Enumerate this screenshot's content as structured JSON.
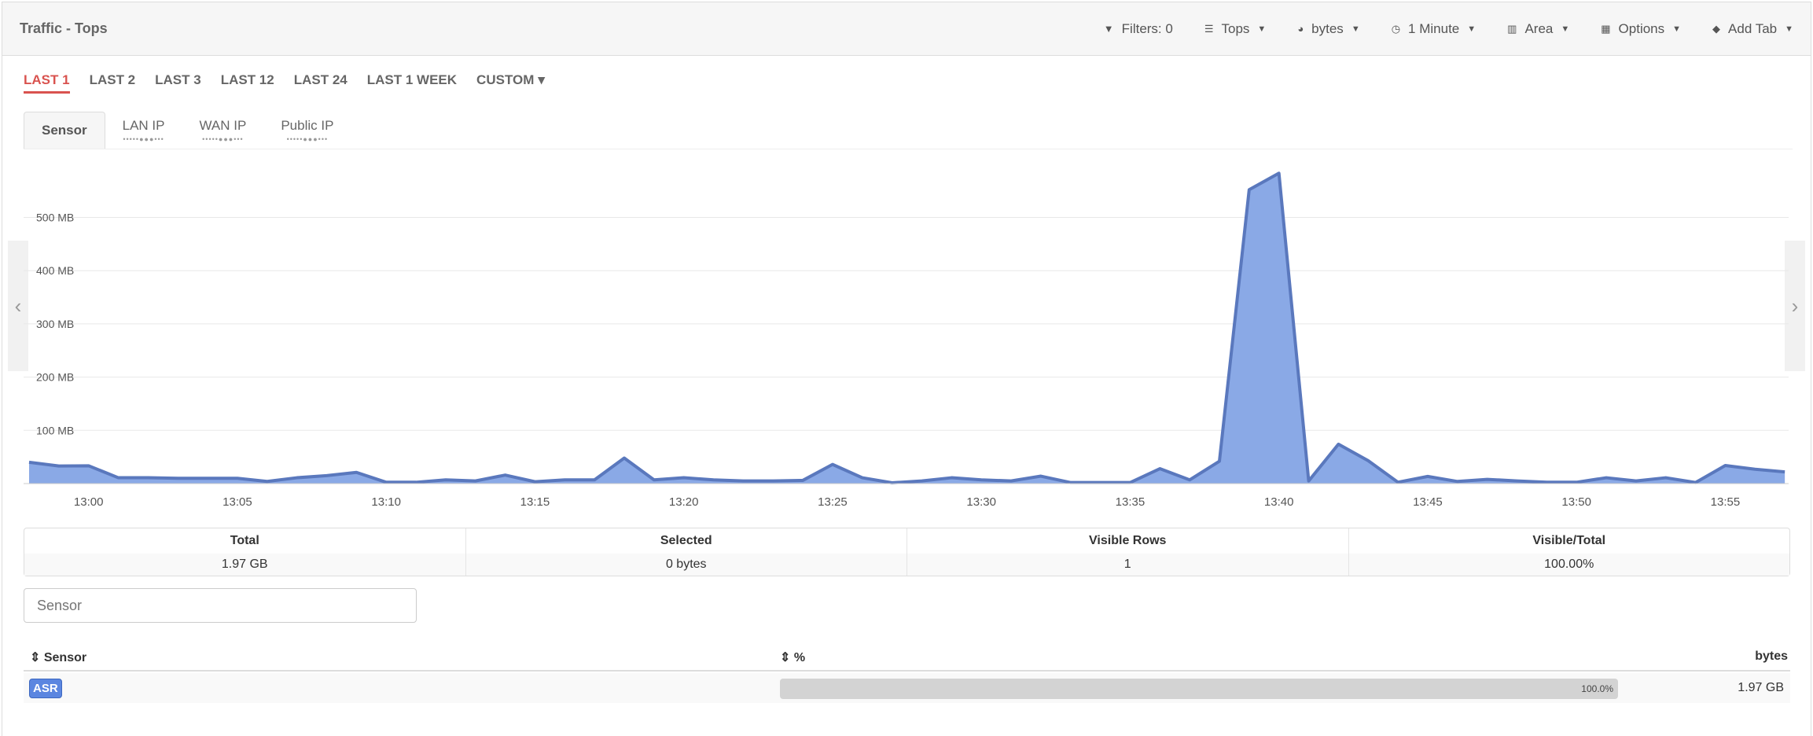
{
  "header": {
    "title": "Traffic - Tops",
    "tools": [
      {
        "icon": "filter-icon",
        "label": "Filters: 0",
        "caret": false
      },
      {
        "icon": "list-icon",
        "label": "Tops",
        "caret": true
      },
      {
        "icon": "dashboard-icon",
        "label": "bytes",
        "caret": true
      },
      {
        "icon": "clock-icon",
        "label": "1 Minute",
        "caret": true
      },
      {
        "icon": "bar-chart-icon",
        "label": "Area",
        "caret": true
      },
      {
        "icon": "grid-icon",
        "label": "Options",
        "caret": true
      },
      {
        "icon": "tag-icon",
        "label": "Add Tab",
        "caret": true
      }
    ]
  },
  "ranges": [
    "LAST 1",
    "LAST 2",
    "LAST 3",
    "LAST 12",
    "LAST 24",
    "LAST 1 WEEK",
    "CUSTOM"
  ],
  "active_range": "LAST 1",
  "tabs": [
    "Sensor",
    "LAN IP",
    "WAN IP",
    "Public IP"
  ],
  "active_tab": "Sensor",
  "chart_data": {
    "type": "area",
    "x_start": "12:58",
    "x_interval": "1 minute",
    "x_ticks": [
      "13:00",
      "13:05",
      "13:10",
      "13:15",
      "13:20",
      "13:25",
      "13:30",
      "13:35",
      "13:40",
      "13:45",
      "13:50",
      "13:55"
    ],
    "y_ticks": [
      "100 MB",
      "200 MB",
      "300 MB",
      "400 MB",
      "500 MB"
    ],
    "ylim": [
      0,
      600
    ],
    "y_unit": "MB",
    "grid": true,
    "color": "#8aa9e6",
    "line_color": "#5a78bd",
    "values": [
      40,
      33,
      33.5,
      11,
      11,
      10,
      10,
      10,
      4,
      11,
      15,
      21,
      2.5,
      2.5,
      7,
      5,
      16,
      3.5,
      7,
      7,
      48,
      7,
      11,
      7,
      5,
      5,
      6,
      36,
      11,
      1.5,
      5,
      11,
      7,
      5,
      14,
      2,
      2,
      2,
      28,
      7,
      42,
      552,
      583,
      5,
      74,
      43,
      2.5,
      13.5,
      4,
      8,
      5,
      2.5,
      2.5,
      11,
      5,
      11,
      2,
      34,
      27,
      22
    ]
  },
  "summary": [
    {
      "label": "Total",
      "value": "1.97 GB"
    },
    {
      "label": "Selected",
      "value": "0 bytes"
    },
    {
      "label": "Visible Rows",
      "value": "1"
    },
    {
      "label": "Visible/Total",
      "value": "100.00%"
    }
  ],
  "filter": {
    "placeholder": "Sensor"
  },
  "table": {
    "columns": [
      "Sensor",
      "%",
      "bytes"
    ],
    "rows": [
      {
        "sensor": "ASR",
        "percent": "100.0%",
        "percent_value": 100,
        "bytes": "1.97 GB"
      }
    ]
  }
}
